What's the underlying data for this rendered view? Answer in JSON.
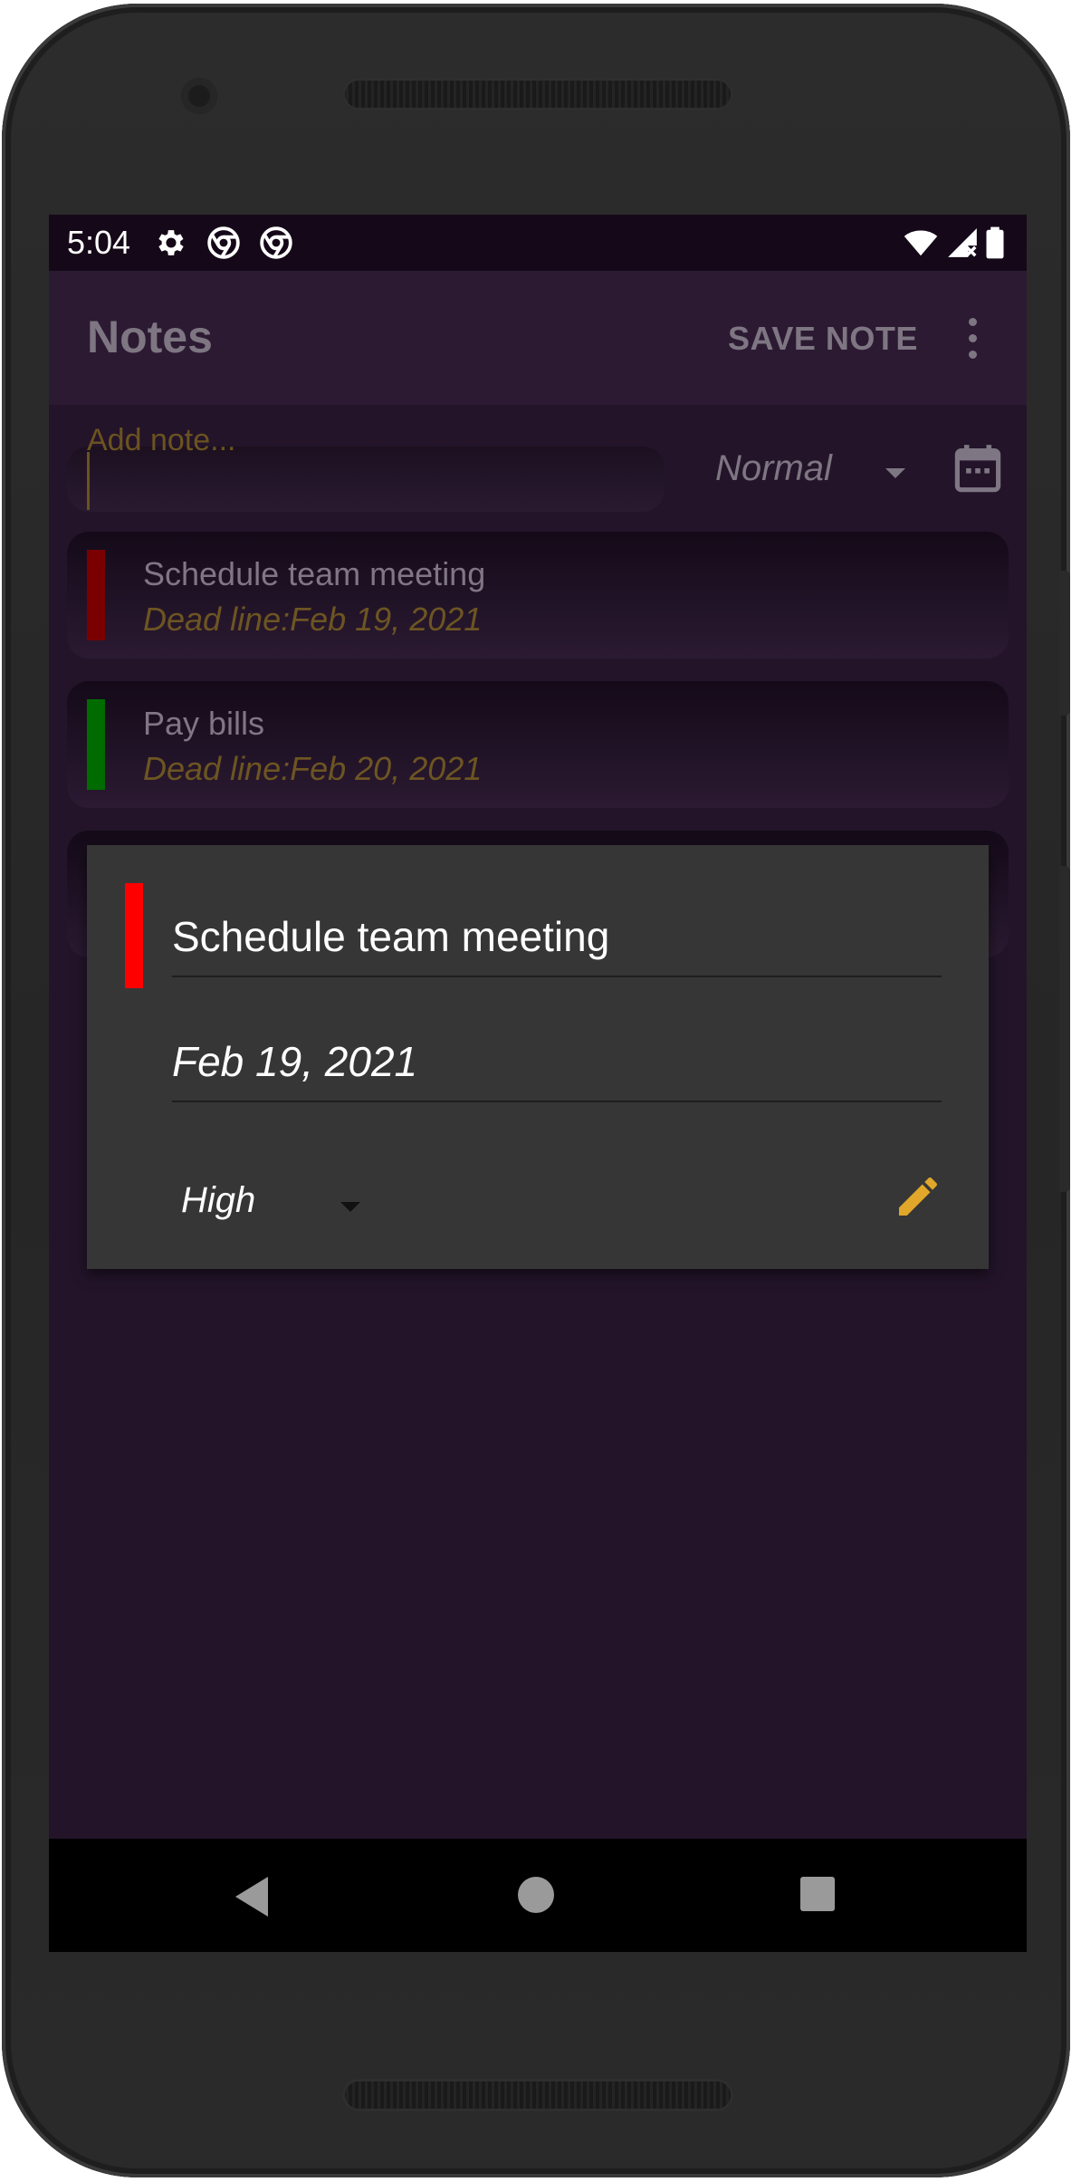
{
  "status_bar": {
    "time": "5:04",
    "left_icons": [
      "settings-icon",
      "chrome-icon",
      "chrome-icon"
    ],
    "right_icons": [
      "wifi-icon",
      "signal-icon",
      "battery-icon"
    ]
  },
  "app_bar": {
    "title": "Notes",
    "save_label": "SAVE NOTE",
    "overflow_icon": "more-vert-icon"
  },
  "composer": {
    "placeholder": "Add note...",
    "priority": "Normal",
    "calendar_icon": "calendar-icon"
  },
  "notes": [
    {
      "title": "Schedule team meeting",
      "deadline": "Dead line:Feb 19, 2021",
      "priority_color": "#7a0000"
    },
    {
      "title": "Pay bills",
      "deadline": "Dead line:Feb 20, 2021",
      "priority_color": "#006b00"
    }
  ],
  "edit_dialog": {
    "title_value": "Schedule team meeting",
    "date_value": "Feb 19, 2021",
    "priority": "High",
    "priority_color": "#ff0000",
    "edit_icon": "pencil-icon",
    "accent_color": "#e0a72a"
  },
  "colors": {
    "background": "#23142a",
    "app_bar": "#2c1a33",
    "status_bar": "#150818",
    "dialog": "#363636",
    "deadline_text": "#6d5522"
  },
  "nav_bar": {
    "icons": [
      "back-icon",
      "home-icon",
      "recents-icon"
    ]
  }
}
